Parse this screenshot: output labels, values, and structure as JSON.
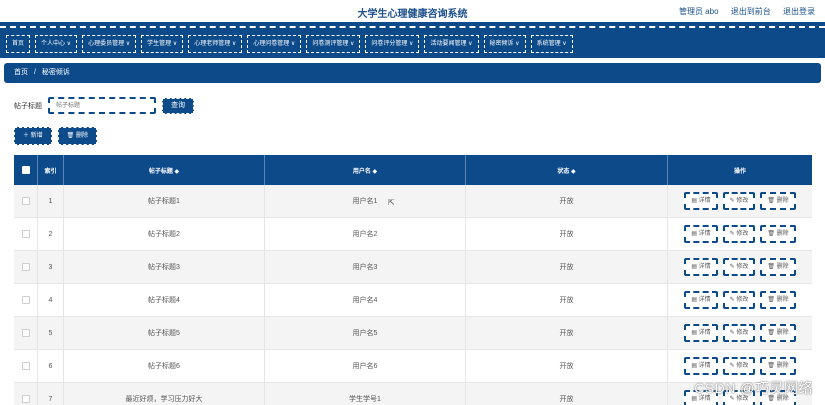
{
  "header": {
    "title": "大学生心理健康咨询系统",
    "user": "管理员 abo",
    "back_link": "退出到前台",
    "logout": "退出登录"
  },
  "nav": [
    "首页",
    "个人中心 ∨",
    "心理委员管理 ∨",
    "学生管理 ∨",
    "心理老师管理 ∨",
    "心理问卷管理 ∨",
    "问卷测评管理 ∨",
    "问卷评分管理 ∨",
    "活动要闻管理 ∨",
    "秘密倾诉 ∨",
    "系统管理 ∨"
  ],
  "breadcrumb": {
    "home": "首页",
    "sep": "/",
    "current": "秘密倾诉"
  },
  "search": {
    "label": "帖子标题",
    "placeholder": "帖子标题",
    "button": "查询"
  },
  "toolbar": {
    "add": "＋ 新增",
    "delete": "🗑 删除"
  },
  "table": {
    "headers": [
      "索引",
      "帖子标题 ◆",
      "用户名 ◆",
      "状态 ◆",
      "操作"
    ],
    "rows": [
      {
        "index": "1",
        "title": "帖子标题1",
        "user": "用户名1",
        "status": "开放"
      },
      {
        "index": "2",
        "title": "帖子标题2",
        "user": "用户名2",
        "status": "开放"
      },
      {
        "index": "3",
        "title": "帖子标题3",
        "user": "用户名3",
        "status": "开放"
      },
      {
        "index": "4",
        "title": "帖子标题4",
        "user": "用户名4",
        "status": "开放"
      },
      {
        "index": "5",
        "title": "帖子标题5",
        "user": "用户名5",
        "status": "开放"
      },
      {
        "index": "6",
        "title": "帖子标题6",
        "user": "用户名6",
        "status": "开放"
      },
      {
        "index": "7",
        "title": "最近好烦，学习压力好大",
        "user": "学生学号1",
        "status": "开放"
      }
    ],
    "ops": {
      "detail": "▤ 详情",
      "edit": "✎ 修改",
      "delete": "🗑 删除"
    }
  },
  "watermark": "CSDN @巧灵网络",
  "colors": {
    "primary": "#0c4a8a",
    "header_text": "#1a4f8b"
  }
}
